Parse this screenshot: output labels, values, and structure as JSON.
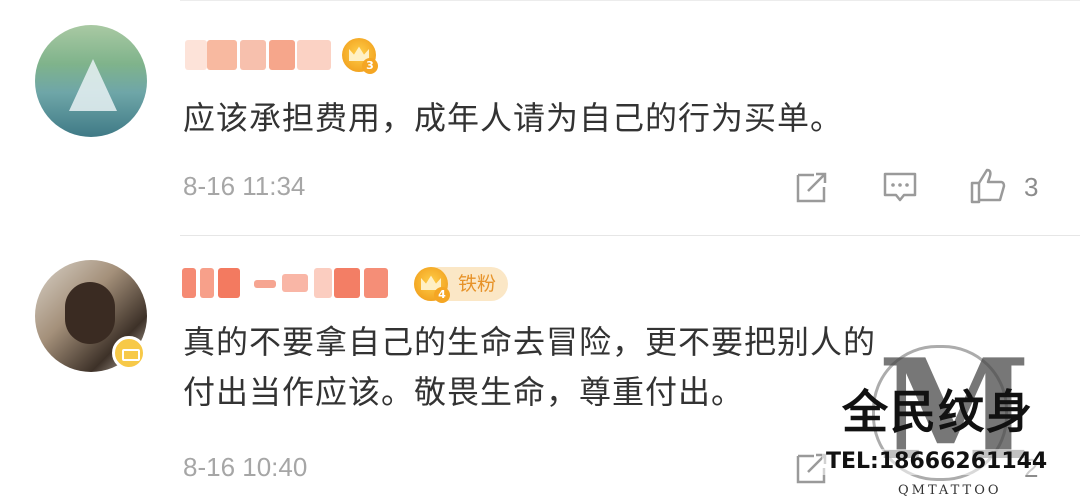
{
  "comments": [
    {
      "username": "",
      "level": "3",
      "text": "应该承担费用，成年人请为自己的行为买单。",
      "time": "8-16 11:34",
      "likes": "3"
    },
    {
      "username": "",
      "level": "4",
      "fan_badge": "铁粉",
      "text_line1": "真的不要拿自己的生命去冒险，更不要把别人的",
      "text_line2": "付出当作应该。敬畏生命，尊重付出。",
      "time": "8-16 10:40",
      "likes": "2"
    }
  ],
  "watermark": {
    "letter": "M",
    "name": "全民纹身",
    "tel": "TEL:18666261144",
    "brand": "QMTATTOO"
  },
  "colors": {
    "text": "#333333",
    "meta": "#a6a6a6",
    "crown": "#f3a623",
    "fan_badge_bg": "#fbe7c6",
    "fan_badge_text": "#e7932a"
  },
  "icons": [
    "repost-icon",
    "comment-icon",
    "like-icon",
    "crown-badge-icon",
    "verified-badge-icon"
  ]
}
